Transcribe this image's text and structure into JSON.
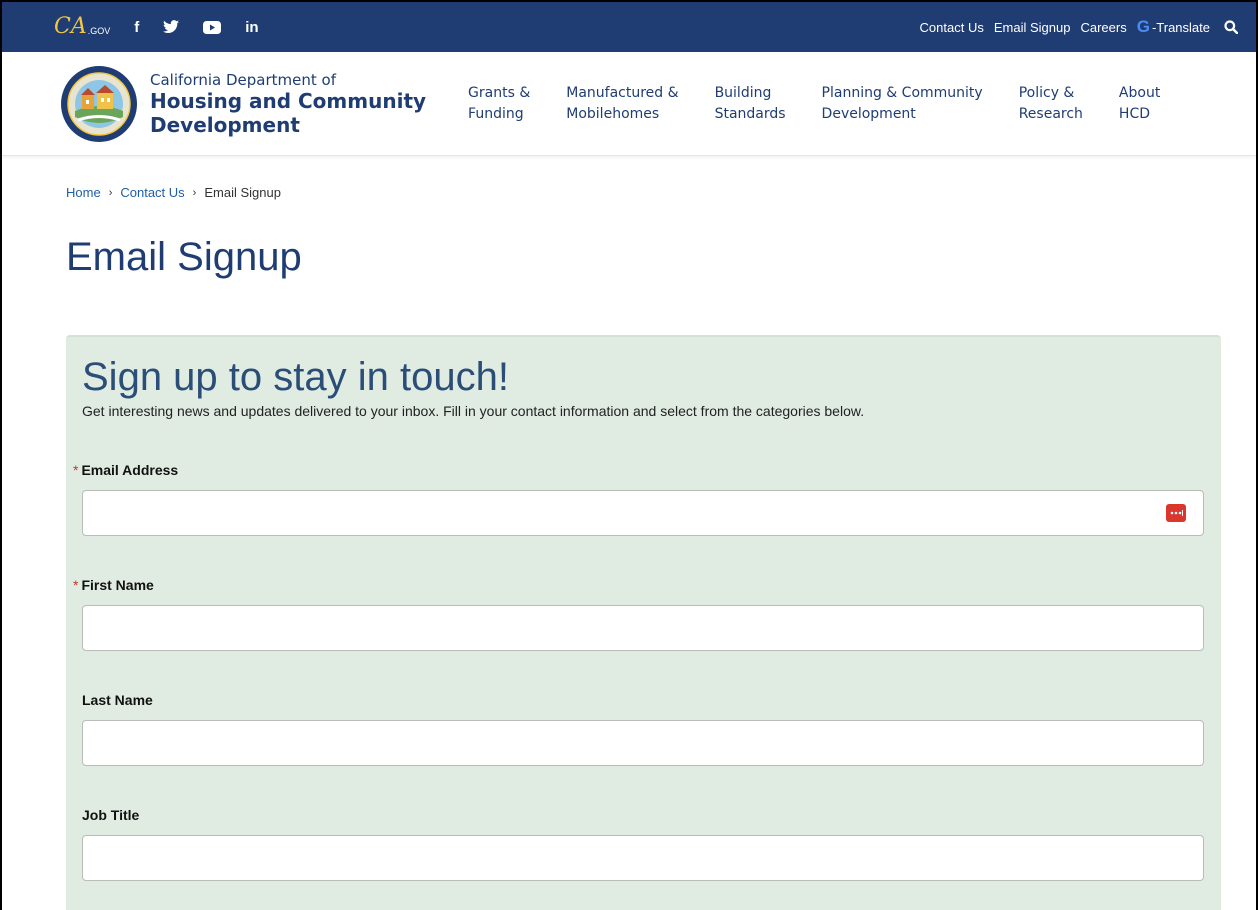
{
  "utility_bar": {
    "logo_ca": "CA",
    "logo_gov": ".GOV",
    "social": [
      {
        "icon": "facebook-icon",
        "glyph": "f"
      },
      {
        "icon": "twitter-icon",
        "glyph": "𝕥"
      },
      {
        "icon": "youtube-icon",
        "glyph": "▶"
      },
      {
        "icon": "linkedin-icon",
        "glyph": "in"
      }
    ],
    "links": [
      "Contact Us",
      "Email Signup",
      "Careers"
    ],
    "translate_g": "G",
    "translate_label": "-Translate",
    "search_icon": "search-icon"
  },
  "header": {
    "dept_line": "California Department of",
    "name_line1": "Housing and Community",
    "name_line2": "Development",
    "nav": [
      {
        "line1": "Grants &",
        "line2": "Funding"
      },
      {
        "line1": "Manufactured &",
        "line2": "Mobilehomes"
      },
      {
        "line1": "Building",
        "line2": "Standards"
      },
      {
        "line1": "Planning & Community",
        "line2": "Development"
      },
      {
        "line1": "Policy &",
        "line2": "Research"
      },
      {
        "line1": "About",
        "line2": "HCD"
      }
    ]
  },
  "breadcrumb": {
    "items": [
      "Home",
      "Contact Us",
      "Email Signup"
    ],
    "separator": "›"
  },
  "page": {
    "title": "Email Signup"
  },
  "form": {
    "heading": "Sign up to stay in touch!",
    "description": "Get interesting news and updates delivered to your inbox. Fill in your contact information and select from the categories below.",
    "required_mark": "*",
    "fields": [
      {
        "label": "Email Address",
        "required": true,
        "value": ""
      },
      {
        "label": "First Name",
        "required": true,
        "value": ""
      },
      {
        "label": "Last Name",
        "required": false,
        "value": ""
      },
      {
        "label": "Job Title",
        "required": false,
        "value": ""
      }
    ]
  },
  "colors": {
    "navy": "#1f3d73",
    "panel": "#e0ebe1",
    "gold": "#f3c640",
    "required": "#c0392b",
    "password_icon": "#d9362e"
  }
}
